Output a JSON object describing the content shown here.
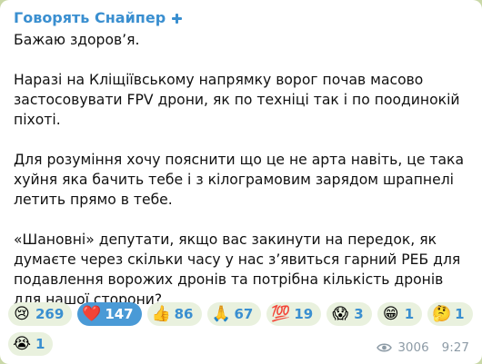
{
  "post": {
    "channel_name": "Говорять Снайпер",
    "verified_icon": "plus-icon",
    "paragraphs": [
      "Бажаю здоров’я.",
      "Наразі на Кліщіївському напрямку ворог почав масово застосовувати FPV дрони, як по техніці так і по поодинокій піхоті.",
      "Для розуміння хочу пояснити що це не арта навіть, це така хуйня яка бачить тебе і з кілограмовим зарядом шрапнелі летить прямо в тебе.",
      "«Шановні» депутати, якщо вас закинути на передок, як думаєте через скільки часу у нас з’явиться гарний РЕБ для подавлення ворожих дронів та потрібна кількість дронів для нашої сторони?"
    ]
  },
  "reactions": [
    {
      "icon": "crying-face-icon",
      "emoji": "😢",
      "count": "269",
      "selected": false
    },
    {
      "icon": "red-heart-icon",
      "emoji": "❤️",
      "count": "147",
      "selected": true
    },
    {
      "icon": "thumbs-up-icon",
      "emoji": "👍",
      "count": "86",
      "selected": false
    },
    {
      "icon": "folded-hands-icon",
      "emoji": "🙏",
      "count": "67",
      "selected": false
    },
    {
      "icon": "hundred-points-icon",
      "emoji": "💯",
      "count": "19",
      "selected": false
    },
    {
      "icon": "screaming-face-icon",
      "emoji": "😱",
      "count": "3",
      "selected": false
    },
    {
      "icon": "grinning-face-icon",
      "emoji": "😁",
      "count": "1",
      "selected": false
    },
    {
      "icon": "thinking-face-icon",
      "emoji": "🤔",
      "count": "1",
      "selected": false
    },
    {
      "icon": "loudly-crying-face-icon",
      "emoji": "😭",
      "count": "1",
      "selected": false
    }
  ],
  "meta": {
    "views_icon": "eye-icon",
    "views": "3006",
    "time": "9:27"
  },
  "colors": {
    "accent": "#3a8fd0",
    "selected_reaction_bg": "#4a9ad6",
    "reaction_bg": "#e9f1de",
    "meta_text": "#8d9ba6",
    "chat_background": "#c9d8a7"
  }
}
